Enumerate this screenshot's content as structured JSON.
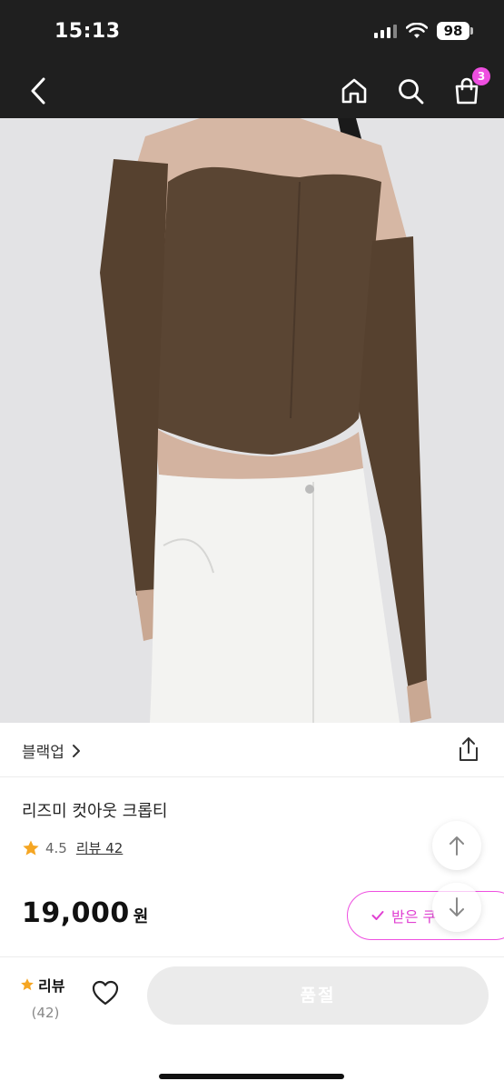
{
  "status": {
    "time": "15:13",
    "battery": "98"
  },
  "header": {
    "cart_count": "3"
  },
  "brand": {
    "name": "블랙업"
  },
  "product": {
    "title": "리즈미 컷아웃 크롭티",
    "rating": "4.5",
    "review_link": "리뷰 42",
    "price": "19,000",
    "currency": "원",
    "coupon_label": "받은 쿠"
  },
  "bottom": {
    "review_label": "리뷰",
    "review_count": "(42)",
    "cta_label": "품절"
  },
  "colors": {
    "accent": "#ee4fe0",
    "star": "#f5a623",
    "header_bg": "#1f1f1f"
  }
}
